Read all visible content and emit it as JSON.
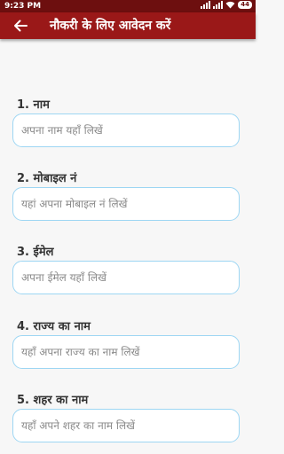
{
  "status_bar": {
    "time": "9:23 PM",
    "battery": "44",
    "icons": [
      "signal-icon",
      "signal-icon",
      "wifi-icon",
      "battery-icon"
    ]
  },
  "app_bar": {
    "title": "नौकरी के लिए आवेदन करें",
    "back_icon": "arrow-left-icon"
  },
  "colors": {
    "status_bar": "#6d0f0f",
    "app_bar": "#9a1818",
    "input_border": "#9dd6f3",
    "background": "#f7f7f7"
  },
  "form": {
    "fields": [
      {
        "label": "1. नाम",
        "placeholder": "अपना नाम यहाँ लिखें",
        "value": ""
      },
      {
        "label": "2. मोबाइल नं",
        "placeholder": "यहां अपना मोबाइल नं लिखें",
        "value": ""
      },
      {
        "label": "3. ईमेल",
        "placeholder": "अपना ईमेल यहाँ लिखें",
        "value": ""
      },
      {
        "label": "4. राज्य का नाम",
        "placeholder": "यहाँ अपना राज्य का नाम लिखें",
        "value": ""
      },
      {
        "label": "5. शहर का नाम",
        "placeholder": "यहाँ अपने शहर का नाम लिखें",
        "value": ""
      }
    ]
  }
}
